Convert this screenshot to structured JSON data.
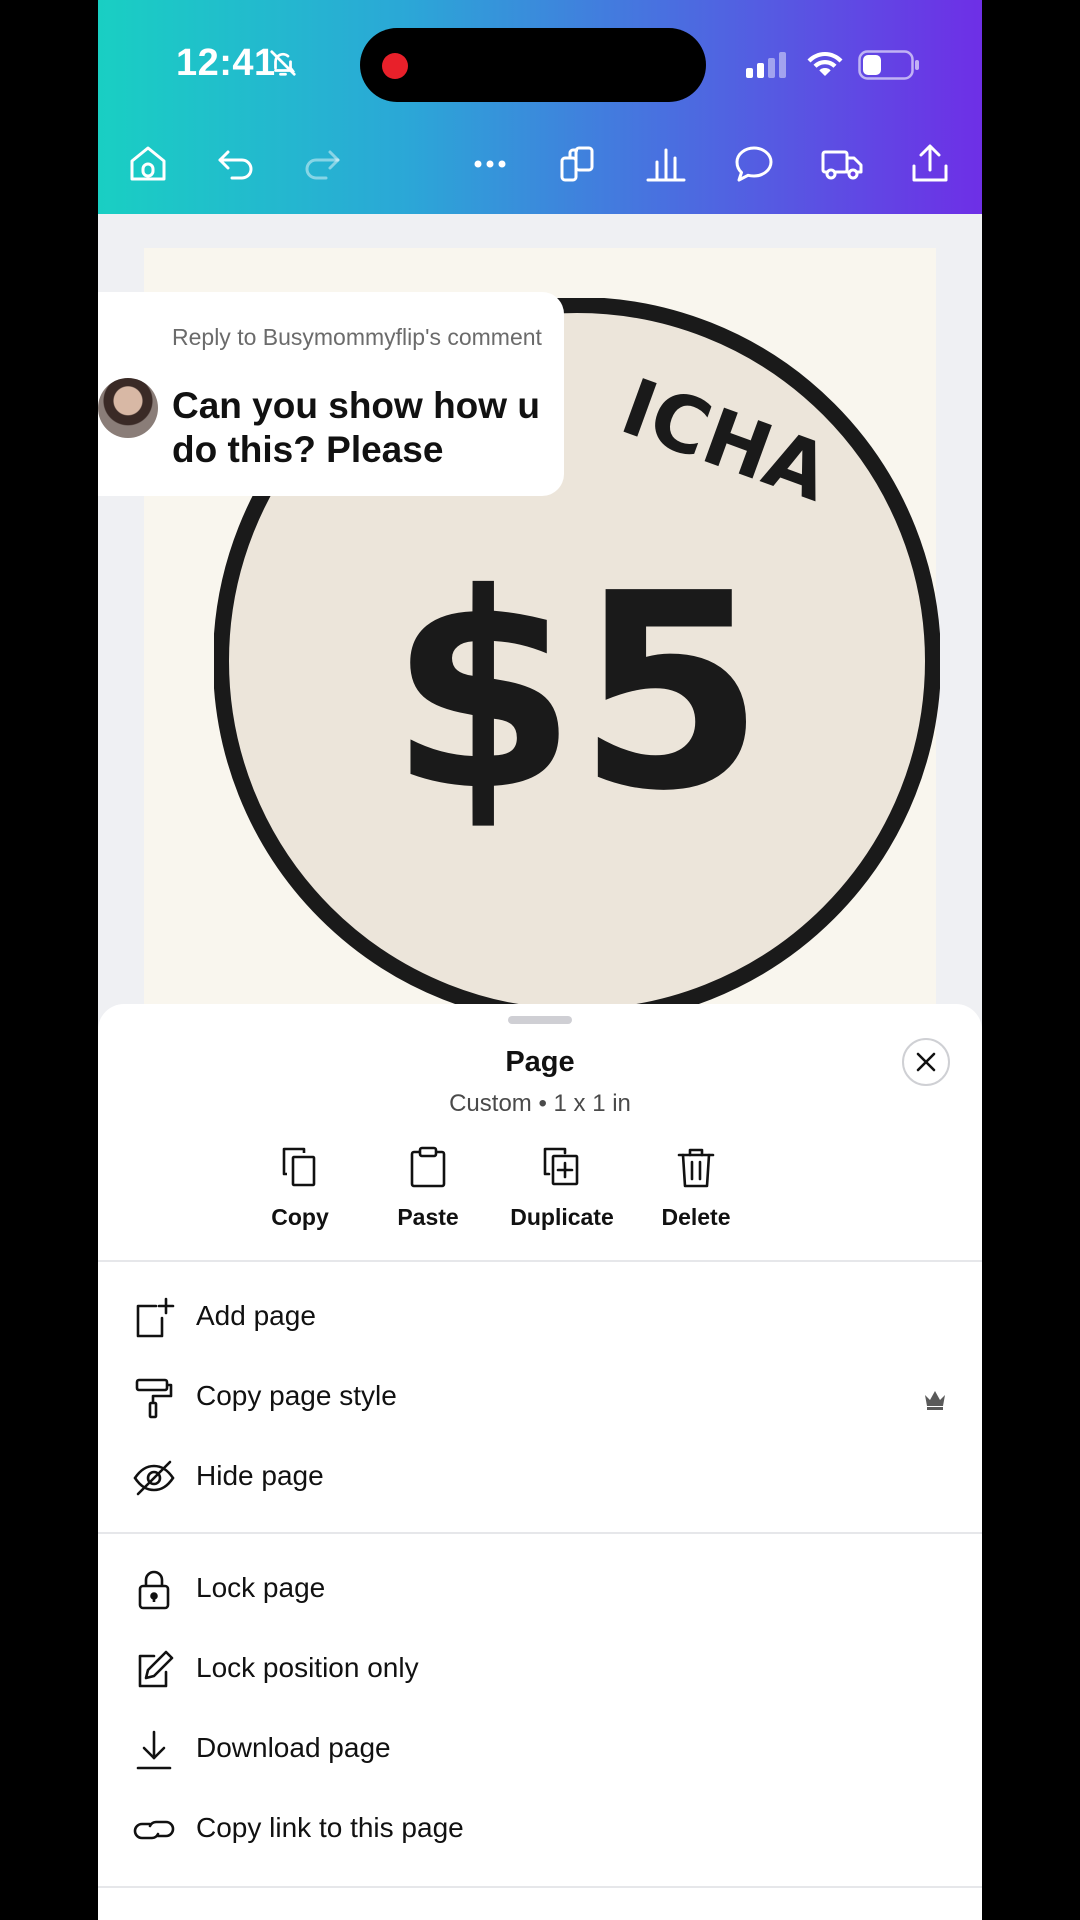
{
  "status_bar": {
    "time": "12:41"
  },
  "toolbar": {
    "icons": [
      "home-icon",
      "undo-icon",
      "redo-icon",
      "more-icon",
      "pages-icon",
      "chart-icon",
      "comment-icon",
      "delivery-truck-icon",
      "share-icon"
    ]
  },
  "design": {
    "arc_text": "ICHA",
    "price": "$5"
  },
  "comment": {
    "reply_to": "Reply to Busymommyflip's comment",
    "message": "Can you show how u do this? Please"
  },
  "sheet": {
    "title": "Page",
    "subtitle": "Custom • 1 x 1 in",
    "actions": [
      {
        "label": "Copy",
        "icon": "copy-icon"
      },
      {
        "label": "Paste",
        "icon": "clipboard-icon"
      },
      {
        "label": "Duplicate",
        "icon": "duplicate-icon"
      },
      {
        "label": "Delete",
        "icon": "trash-icon"
      }
    ],
    "menu_group1": [
      {
        "label": "Add page",
        "icon": "add-page-icon"
      },
      {
        "label": "Copy page style",
        "icon": "paint-roller-icon",
        "premium": true
      },
      {
        "label": "Hide page",
        "icon": "eye-off-icon"
      }
    ],
    "menu_group2": [
      {
        "label": "Lock page",
        "icon": "lock-icon"
      },
      {
        "label": "Lock position only",
        "icon": "edit-lock-icon"
      },
      {
        "label": "Download page",
        "icon": "download-icon"
      },
      {
        "label": "Copy link to this page",
        "icon": "link-icon"
      }
    ]
  },
  "colors": {
    "header_start": "#19cfc3",
    "header_end": "#6e2fe6",
    "record_dot": "#e8202a",
    "coin_fill": "#ece5da"
  }
}
